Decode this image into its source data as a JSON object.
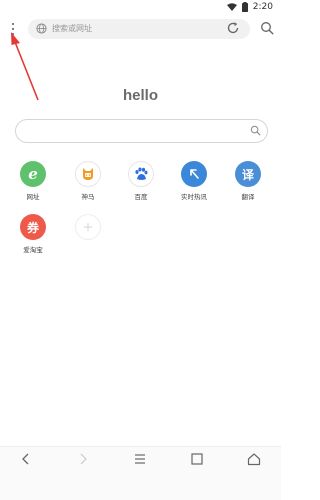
{
  "status": {
    "time": "2:20"
  },
  "top_bar": {
    "url_placeholder": "搜索或网址"
  },
  "main": {
    "title": "hello"
  },
  "shortcuts": [
    {
      "label": "网址",
      "glyph": "e",
      "color": "#5fc16e"
    },
    {
      "label": "神马",
      "glyph": "",
      "color": "#ffffff"
    },
    {
      "label": "百度",
      "glyph": "",
      "color": "#ffffff"
    },
    {
      "label": "实时热讯",
      "glyph": "",
      "color": "#3b87d8"
    },
    {
      "label": "翻译",
      "glyph": "译",
      "color": "#4a8ed6"
    },
    {
      "label": "爱淘宝",
      "glyph": "券",
      "color": "#ee5a4a"
    }
  ],
  "icons": {
    "menu": "more-vertical-icon",
    "globe": "globe-icon",
    "refresh": "refresh-icon",
    "search": "search-icon",
    "add": "add-icon",
    "back": "back-arrow-icon",
    "forward": "forward-arrow-icon",
    "menu_bottom": "hamburger-icon",
    "tabs": "tabs-icon",
    "home": "home-icon"
  },
  "colors": {
    "annotation_arrow": "#e53935"
  }
}
